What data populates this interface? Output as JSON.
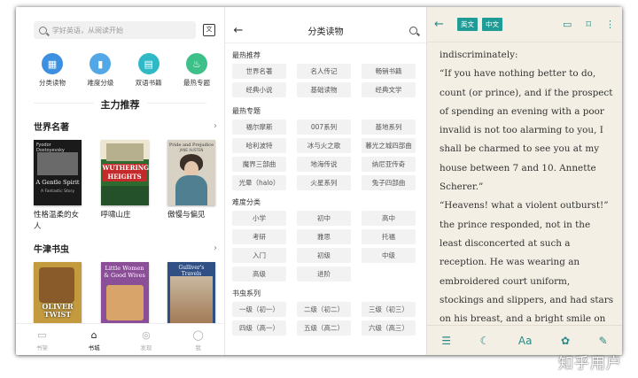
{
  "home": {
    "search_placeholder": "学好英语，从阅读开始",
    "side_icon": "文",
    "categories": [
      {
        "label": "分类读物",
        "icon": "grid-icon",
        "color": "#3d8fe0"
      },
      {
        "label": "难度分级",
        "icon": "levels-icon",
        "color": "#52a8e6"
      },
      {
        "label": "双语书籍",
        "icon": "bilingual-icon",
        "color": "#2fb9c7"
      },
      {
        "label": "最热专题",
        "icon": "fire-icon",
        "color": "#3dc08a"
      }
    ],
    "featured_title": "主力推荐",
    "rows": [
      {
        "title": "世界名著",
        "books": [
          {
            "title": "性格温柔的女人",
            "cover_title": "A Gentle Spirit",
            "cover_author": "Fyodor Dostoyevsky",
            "cover_sub": "A Fantastic Story",
            "cover_color": "#1a1a1a"
          },
          {
            "title": "呼啸山庄",
            "cover_title": "WUTHERING HEIGHTS",
            "cover_author": "",
            "cover_sub": "",
            "cover_color": "#2e6b30"
          },
          {
            "title": "傲慢与偏见",
            "cover_title": "Pride and Prejudice",
            "cover_author": "JANE AUSTEN",
            "cover_sub": "",
            "cover_color": "#d8d2c4"
          }
        ]
      },
      {
        "title": "牛津书虫",
        "books": [
          {
            "title": "",
            "cover_title": "OLIVER TWIST",
            "cover_author": "",
            "cover_sub": "",
            "cover_color": "#c49a3e"
          },
          {
            "title": "",
            "cover_title": "Little Women & Good Wives",
            "cover_author": "",
            "cover_sub": "",
            "cover_color": "#8a4f96"
          },
          {
            "title": "",
            "cover_title": "Gulliver's Travels",
            "cover_author": "",
            "cover_sub": "",
            "cover_color": "#2f4f85"
          }
        ]
      }
    ],
    "tabs": [
      {
        "label": "书架",
        "icon": "bookshelf-icon",
        "active": false
      },
      {
        "label": "书城",
        "icon": "home-icon",
        "active": true
      },
      {
        "label": "发现",
        "icon": "compass-icon",
        "active": false
      },
      {
        "label": "我",
        "icon": "user-icon",
        "active": false
      }
    ]
  },
  "catalog": {
    "title": "分类读物",
    "groups": [
      {
        "title": "最热推荐",
        "chips": [
          "世界名著",
          "名人传记",
          "畅销书籍",
          "经典小说",
          "基础读物",
          "经典文学"
        ]
      },
      {
        "title": "最热专题",
        "chips": [
          "福尔摩斯",
          "007系列",
          "基地系列",
          "哈利波特",
          "冰与火之歌",
          "暮光之城四部曲",
          "魔界三部曲",
          "地海传说",
          "纳尼亚传奇",
          "光晕（halo）",
          "火星系列",
          "兔子四部曲"
        ]
      },
      {
        "title": "难度分类",
        "chips": [
          "小学",
          "初中",
          "高中",
          "考研",
          "雅思",
          "托福",
          "入门",
          "初级",
          "中级",
          "高级",
          "进阶"
        ]
      },
      {
        "title": "书虫系列",
        "chips": [
          "一级（初一）",
          "二级（初二）",
          "三级（初三）",
          "四级（高一）",
          "五级（高二）",
          "六级（高三）"
        ]
      }
    ]
  },
  "reader": {
    "lang_en": "英文",
    "lang_zh": "中文",
    "paragraphs": [
      "indiscriminately:",
      "“If you have nothing better to do, count (or prince), and if the prospect of spending an evening with a poor invalid is not too alarming to you, I shall be charmed to see you at my house between 7 and 10. Annette Scherer.”",
      "“Heavens! what a violent outburst!” the prince responded, not in the least disconcerted at such a reception. He was wearing an embroidered court uniform, stockings and slippers, and had stars on his breast, and a bright smile on his flat face."
    ],
    "toolbar": [
      "toc-icon",
      "night-mode-icon",
      "font-size-icon",
      "theme-icon",
      "annotate-icon"
    ],
    "font_size_label": "Aa"
  },
  "watermark": "知乎用户",
  "colors": {
    "accent": "#1f9c96",
    "reader_bg": "#f3efe4"
  }
}
